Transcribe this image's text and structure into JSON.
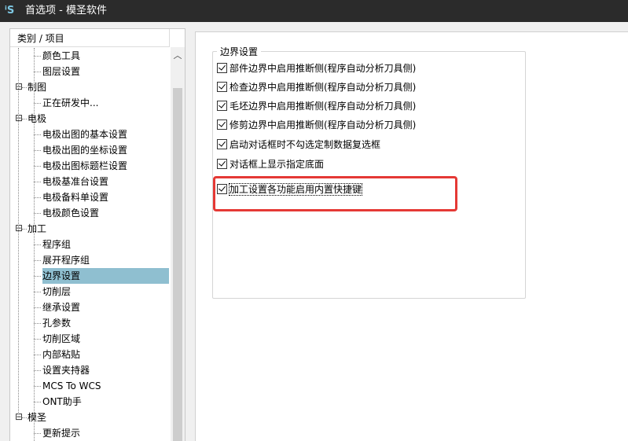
{
  "window": {
    "title": "首选项 - 模圣软件",
    "icon_text": "MS"
  },
  "tree": {
    "header": "类别 / 项目",
    "rows": [
      {
        "label": "颜色工具",
        "level": 1,
        "type": "leaf"
      },
      {
        "label": "图层设置",
        "level": 1,
        "type": "leaf"
      },
      {
        "label": "制图",
        "level": 0,
        "type": "group"
      },
      {
        "label": "正在研发中...",
        "level": 1,
        "type": "leaf"
      },
      {
        "label": "电极",
        "level": 0,
        "type": "group"
      },
      {
        "label": "电极出图的基本设置",
        "level": 1,
        "type": "leaf"
      },
      {
        "label": "电极出图的坐标设置",
        "level": 1,
        "type": "leaf"
      },
      {
        "label": "电极出图标题栏设置",
        "level": 1,
        "type": "leaf"
      },
      {
        "label": "电极基准台设置",
        "level": 1,
        "type": "leaf"
      },
      {
        "label": "电极备料单设置",
        "level": 1,
        "type": "leaf"
      },
      {
        "label": "电极颜色设置",
        "level": 1,
        "type": "leaf"
      },
      {
        "label": "加工",
        "level": 0,
        "type": "group"
      },
      {
        "label": "程序组",
        "level": 1,
        "type": "leaf"
      },
      {
        "label": "展开程序组",
        "level": 1,
        "type": "leaf"
      },
      {
        "label": "边界设置",
        "level": 1,
        "type": "leaf",
        "selected": true
      },
      {
        "label": "切削层",
        "level": 1,
        "type": "leaf"
      },
      {
        "label": "继承设置",
        "level": 1,
        "type": "leaf"
      },
      {
        "label": "孔参数",
        "level": 1,
        "type": "leaf"
      },
      {
        "label": "切削区域",
        "level": 1,
        "type": "leaf"
      },
      {
        "label": "内部粘贴",
        "level": 1,
        "type": "leaf"
      },
      {
        "label": "设置夹持器",
        "level": 1,
        "type": "leaf"
      },
      {
        "label": "MCS To WCS",
        "level": 1,
        "type": "leaf"
      },
      {
        "label": "ONT助手",
        "level": 1,
        "type": "leaf"
      },
      {
        "label": "模圣",
        "level": 0,
        "type": "group"
      },
      {
        "label": "更新提示",
        "level": 1,
        "type": "leaf"
      }
    ]
  },
  "settings": {
    "group_title": "边界设置",
    "options": [
      {
        "label": "部件边界中启用推断侧(程序自动分析刀具侧)",
        "checked": true
      },
      {
        "label": "检查边界中启用推断侧(程序自动分析刀具侧)",
        "checked": true
      },
      {
        "label": "毛坯边界中启用推断侧(程序自动分析刀具侧)",
        "checked": true
      },
      {
        "label": "修剪边界中启用推断侧(程序自动分析刀具侧)",
        "checked": true
      },
      {
        "label": "启动对话框时不勾选定制数据复选框",
        "checked": true
      },
      {
        "label": "对话框上显示指定底面",
        "checked": true
      },
      {
        "label": "加工设置各功能启用内置快捷键",
        "checked": true,
        "focused": true
      }
    ]
  },
  "colors": {
    "selection": "#8fbfd0",
    "highlight_box": "#e53935",
    "titlebar": "#2b2b2b"
  },
  "icons": {
    "scroll_up": "chevron-up-icon",
    "collapse": "minus-icon",
    "checkbox": "checkmark-icon"
  }
}
